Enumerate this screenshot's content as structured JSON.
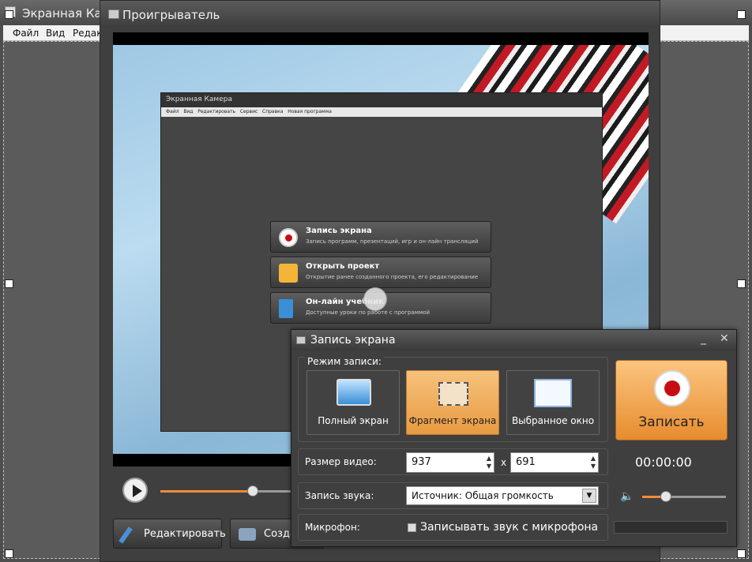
{
  "background_window": {
    "title": "Экранная Камера",
    "menu": [
      "Файл",
      "Вид",
      "Редакт"
    ]
  },
  "player": {
    "title": "Проигрыватель",
    "inner_app": {
      "title": "Экранная Камера",
      "menu_items": [
        "Файл",
        "Вид",
        "Редактировать",
        "Сервис",
        "Справка",
        "Новая программа"
      ],
      "buttons": [
        {
          "title": "Запись экрана",
          "desc": "Запись программ, презентаций, игр и он-лайн трансляций"
        },
        {
          "title": "Открыть проект",
          "desc": "Открытие ранее созданного проекта, его редактирование"
        },
        {
          "title": "Он-лайн учебник",
          "desc": "Доступные уроки по работе с программой"
        }
      ]
    },
    "seek_progress": 0.69,
    "buttons": {
      "edit": "Редактировать",
      "create": "Созда"
    }
  },
  "record_dialog": {
    "title": "Запись экрана",
    "minimize_glyph": "_",
    "close_glyph": "✕",
    "mode_group_label": "Режим записи:",
    "modes": [
      {
        "label": "Полный экран",
        "selected": false
      },
      {
        "label": "Фрагмент экрана",
        "selected": true
      },
      {
        "label": "Выбранное окно",
        "selected": false
      }
    ],
    "record_button_label": "Записать",
    "video_size_label": "Размер видео:",
    "width_value": "937",
    "height_value": "691",
    "size_separator": "x",
    "timer": "00:00:00",
    "audio_label": "Запись звука:",
    "audio_source": "Источник: Общая громкость",
    "volume_level": 0.28,
    "mic_label": "Микрофон:",
    "mic_checkbox_label": "Записывать звук с микрофона",
    "mic_checked": false
  },
  "icons": [
    "monitor-icon",
    "fragment-icon",
    "window-icon",
    "record-icon",
    "speaker-icon",
    "pencil-icon",
    "camera-icon"
  ],
  "colors": {
    "accent": "#f08a3c",
    "record_red": "#c70d12"
  }
}
